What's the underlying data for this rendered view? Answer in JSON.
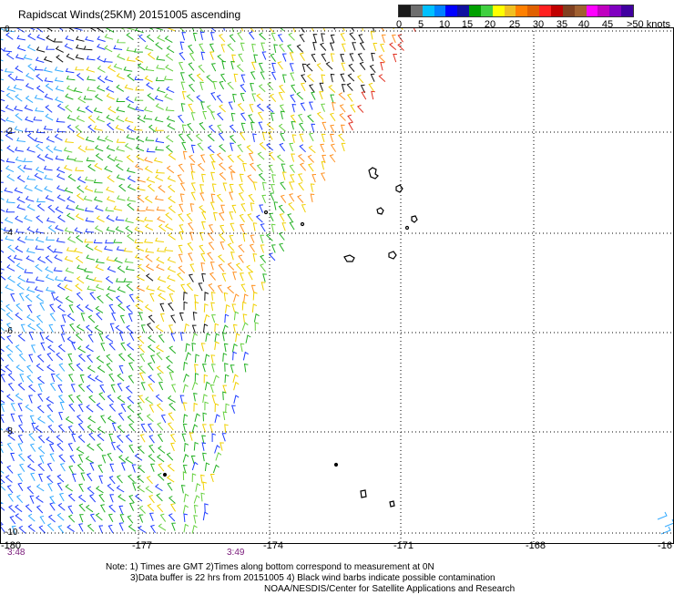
{
  "title": "Rapidscat Winds(25KM) 20151005 ascending",
  "legend": {
    "colors": [
      "#1a1a1a",
      "#6e6e6e",
      "#00c0ff",
      "#0080ff",
      "#0000ff",
      "#1010a0",
      "#00a000",
      "#40d040",
      "#ffff00",
      "#f0c020",
      "#ff8000",
      "#e06000",
      "#ff2020",
      "#c00000",
      "#804020",
      "#a06030",
      "#ff00ff",
      "#c000c0",
      "#8000c0",
      "#4000a0"
    ],
    "labels": [
      "0",
      "5",
      "10",
      "15",
      "20",
      "25",
      "30",
      "35",
      "40",
      "45",
      ">50 knots"
    ]
  },
  "axes": {
    "lon_labels": [
      "-180",
      "-177",
      "-174",
      "-171",
      "-168",
      "-16"
    ],
    "lat_labels": [
      "0",
      "-2",
      "-4",
      "-6",
      "-8",
      "-10"
    ],
    "times": [
      "3:48",
      "3:49"
    ]
  },
  "notes": [
    "Note: 1) Times are GMT 2)Times along bottom correspond to measurement at 0N",
    "3)Data buffer is 22 hrs from 20151005 4) Black wind barbs indicate possible contamination",
    "NOAA/NESDIS/Center for Satellite Applications and Research"
  ]
}
